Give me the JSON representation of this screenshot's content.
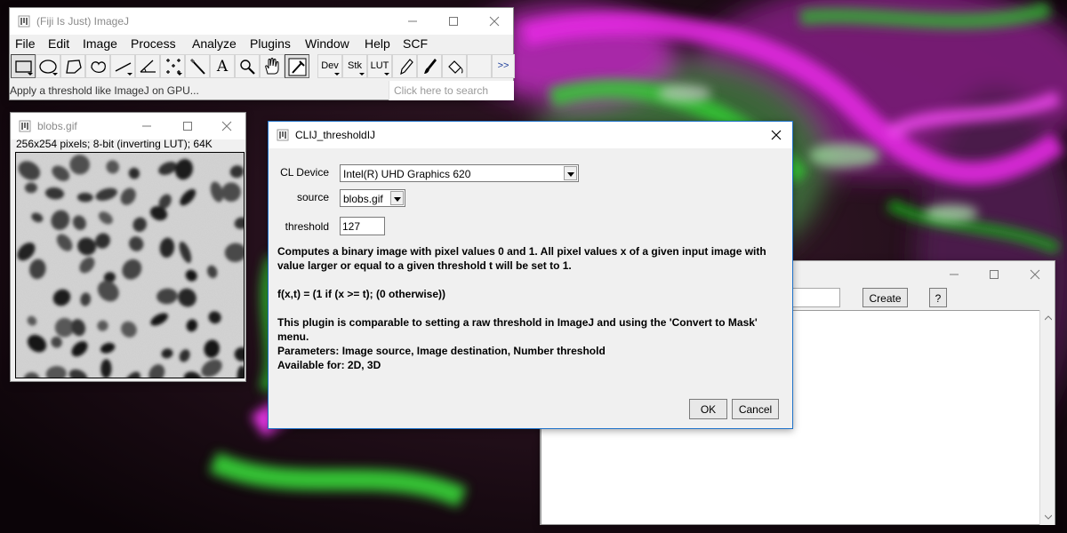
{
  "imagej": {
    "title": "(Fiji Is Just) ImageJ",
    "menu": [
      "File",
      "Edit",
      "Image",
      "Process",
      "Analyze",
      "Plugins",
      "Window",
      "Help",
      "SCF"
    ],
    "tools": [
      {
        "icon": "rectangle-select-icon"
      },
      {
        "icon": "oval-select-icon"
      },
      {
        "icon": "polygon-select-icon"
      },
      {
        "icon": "freehand-select-icon"
      },
      {
        "icon": "line-tool-icon"
      },
      {
        "icon": "angle-tool-icon"
      },
      {
        "icon": "multipoint-tool-icon"
      },
      {
        "icon": "wand-tool-icon"
      },
      {
        "icon": "text-tool-icon",
        "label": "A"
      },
      {
        "icon": "magnifier-icon"
      },
      {
        "icon": "hand-tool-icon"
      },
      {
        "icon": "color-picker-icon"
      },
      {
        "icon": "dev-menu-icon",
        "label": "Dev"
      },
      {
        "icon": "stk-menu-icon",
        "label": "Stk"
      },
      {
        "icon": "lut-menu-icon",
        "label": "LUT"
      },
      {
        "icon": "pencil-icon"
      },
      {
        "icon": "brush-icon"
      },
      {
        "icon": "flood-fill-icon"
      },
      {
        "icon": "empty-slot"
      },
      {
        "icon": "more-tools-icon",
        "label": ">>"
      }
    ],
    "status": "Apply a threshold like ImageJ on GPU...",
    "search_placeholder": "Click here to search"
  },
  "blobs": {
    "title": "blobs.gif",
    "info": "256x254 pixels; 8-bit (inverting LUT); 64K"
  },
  "bg_window": {
    "create_label": "Create",
    "help_label": "?"
  },
  "dialog": {
    "title": "CLIJ_thresholdIJ",
    "cl_device_label": "CL Device",
    "cl_device_value": "Intel(R) UHD Graphics 620",
    "source_label": "source",
    "source_value": "blobs.gif",
    "threshold_label": "threshold",
    "threshold_value": "127",
    "desc_line1": "Computes a binary image with pixel values 0 and 1. All pixel values x of a given input image with",
    "desc_line2": "value larger or equal to a given threshold t will be set to 1.",
    "formula": "f(x,t) = (1 if (x >= t); (0 otherwise))",
    "note": "This plugin is comparable to setting a raw threshold in ImageJ and using the 'Convert to Mask' menu.",
    "params": "Parameters: Image source, Image destination, Number threshold",
    "available": "Available for: 2D, 3D",
    "ok_label": "OK",
    "cancel_label": "Cancel"
  }
}
